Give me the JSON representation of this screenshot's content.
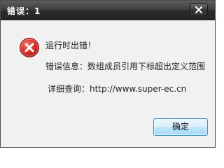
{
  "window": {
    "title": "错误：1"
  },
  "message": {
    "heading": "运行时出错！",
    "detail": "错误信息：数组成员引用下标超出定义范围",
    "link": "详细查询：http://www.super-ec.cn"
  },
  "buttons": {
    "ok_label": "确定"
  },
  "icons": {
    "status": "error-icon",
    "close": "close-icon"
  },
  "colors": {
    "titlebar": "#2b2b2b",
    "error_red": "#d9302a",
    "button_border": "#3c8ec4"
  }
}
